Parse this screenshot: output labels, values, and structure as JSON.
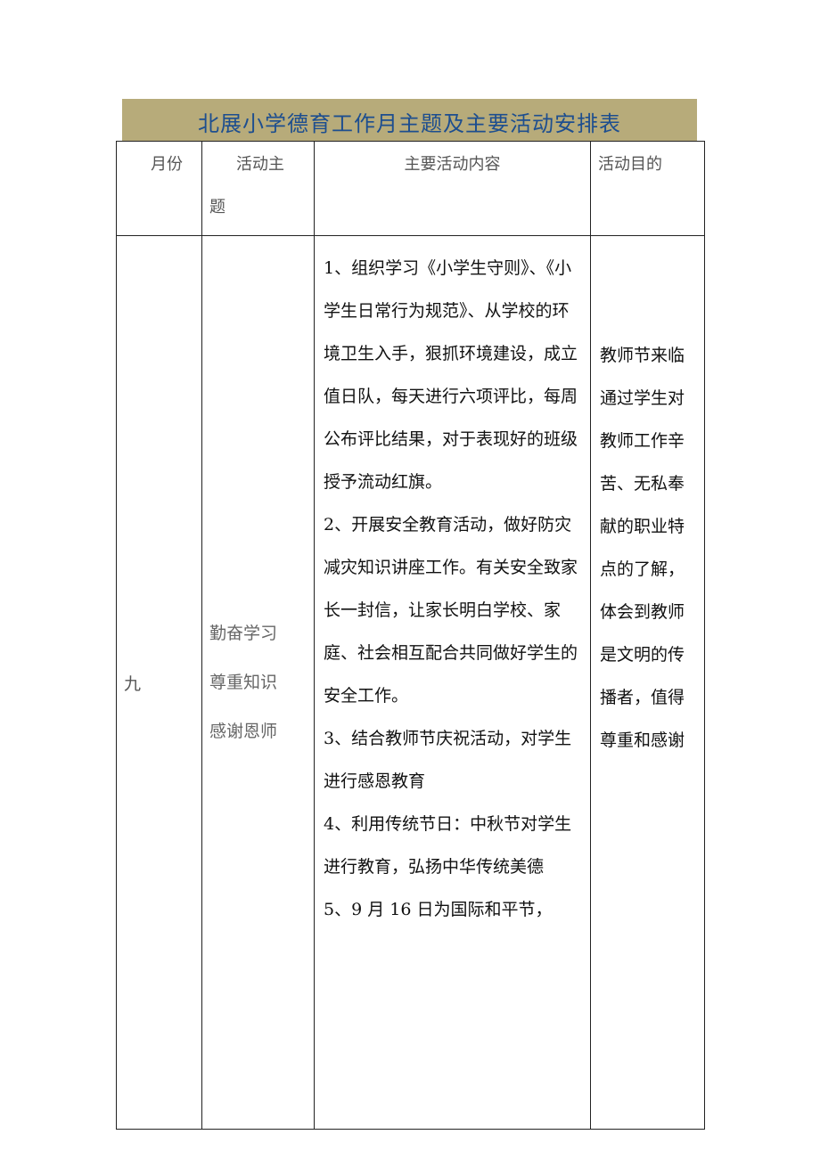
{
  "title": "北展小学德育工作月主题及主要活动安排表",
  "colors": {
    "title_bg": "#b7ab7a",
    "title_text": "#1d4e8f"
  },
  "table": {
    "headers": {
      "month": "月份",
      "theme_line1": "活动主",
      "theme_line2": "题",
      "content": "主要活动内容",
      "goal": "活动目的"
    },
    "rows": [
      {
        "month": "九",
        "theme_lines": [
          "勤奋学习",
          "尊重知识",
          "感谢恩师"
        ],
        "content_paragraphs": [
          "1、组织学习《小学生守则》、《小学生日常行为规范》、从学校的环境卫生入手，狠抓环境建设，成立值日队，每天进行六项评比，每周公布评比结果，对于表现好的班级授予流动红旗。",
          "2、开展安全教育活动，做好防灾减灾知识讲座工作。有关安全致家长一封信，让家长明白学校、家庭、社会相互配合共同做好学生的安全工作。",
          "3、结合教师节庆祝活动，对学生进行感恩教育",
          "4、利用传统节日：中秋节对学生进行教育，弘扬中华传统美德",
          "5、9 月 16 日为国际和平节，"
        ],
        "goal_lines": [
          "教师节来临",
          "通过学生对",
          "教师工作辛",
          "苦、无私奉",
          "献的职业特",
          "点的了解，",
          "体会到教师",
          "是文明的传",
          "播者，值得",
          "尊重和感谢"
        ]
      }
    ]
  }
}
